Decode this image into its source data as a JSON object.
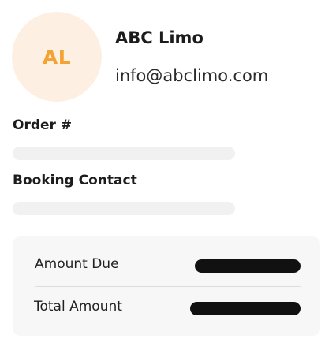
{
  "company": {
    "initials": "AL",
    "name": "ABC Limo",
    "email": "info@abclimo.com"
  },
  "order": {
    "label": "Order #"
  },
  "booking": {
    "label": "Booking Contact"
  },
  "summary": {
    "amount_due_label": "Amount Due",
    "total_amount_label": "Total Amount"
  },
  "colors": {
    "avatar_background": "#fdf0e2",
    "avatar_initials": "#f3a332",
    "placeholder": "#f1f1f1",
    "card_background": "#f7f7f7",
    "value_pill": "#111111"
  }
}
